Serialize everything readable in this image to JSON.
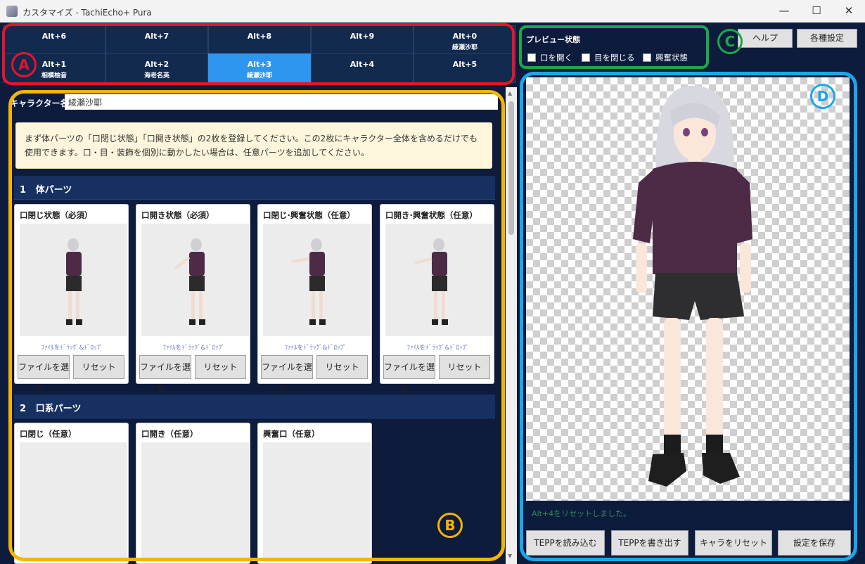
{
  "window": {
    "title": "カスタマイズ - TachiEcho+ Pura",
    "minimize": "—",
    "maximize": "☐",
    "close": "✕"
  },
  "shortcuts": [
    {
      "key": "Alt+6",
      "name": ""
    },
    {
      "key": "Alt+7",
      "name": ""
    },
    {
      "key": "Alt+8",
      "name": ""
    },
    {
      "key": "Alt+9",
      "name": ""
    },
    {
      "key": "Alt+0",
      "name": "綾瀬沙耶"
    },
    {
      "key": "Alt+1",
      "name": "相模柚音"
    },
    {
      "key": "Alt+2",
      "name": "海老名英"
    },
    {
      "key": "Alt+3",
      "name": "綾瀬沙耶",
      "active": true
    },
    {
      "key": "Alt+4",
      "name": ""
    },
    {
      "key": "Alt+5",
      "name": ""
    }
  ],
  "character": {
    "label": "キャラクター名",
    "value": "綾瀬沙耶"
  },
  "info": "まず体パーツの「口閉じ状態」「口開き状態」の2枚を登録してください。この2枚にキャラクター全体を含めるだけでも使用できます。口・目・装飾を個別に動かしたい場合は、任意パーツを追加してください。",
  "sections": {
    "body": {
      "number": "1",
      "title": "体パーツ"
    },
    "mouth": {
      "number": "2",
      "title": "口系パーツ"
    }
  },
  "body_cards": [
    {
      "title": "口閉じ状態（必須）",
      "drop": "ﾌｧｲﾙをﾄﾞﾗｯｸﾞ&ﾄﾞﾛｯﾌﾟ",
      "select": "ファイルを選択...",
      "reset": "リセット"
    },
    {
      "title": "口開き状態（必須）",
      "drop": "ﾌｧｲﾙをﾄﾞﾗｯｸﾞ&ﾄﾞﾛｯﾌﾟ",
      "select": "ファイルを選択...",
      "reset": "リセット"
    },
    {
      "title": "口閉じ·興奮状態（任意）",
      "drop": "ﾌｧｲﾙをﾄﾞﾗｯｸﾞ&ﾄﾞﾛｯﾌﾟ",
      "select": "ファイルを選択...",
      "reset": "リセット"
    },
    {
      "title": "口開き·興奮状態（任意）",
      "drop": "ﾌｧｲﾙをﾄﾞﾗｯｸﾞ&ﾄﾞﾛｯﾌﾟ",
      "select": "ファイルを選択...",
      "reset": "リセット"
    }
  ],
  "mouth_cards": [
    {
      "title": "口閉じ（任意）"
    },
    {
      "title": "口開き（任意）"
    },
    {
      "title": "興奮口（任意）"
    }
  ],
  "preview": {
    "title": "プレビュー状態",
    "options": [
      "口を開く",
      "目を閉じる",
      "興奮状態"
    ]
  },
  "top_buttons": {
    "help": "ヘルプ",
    "settings": "各種設定"
  },
  "status_message": "Alt+4をリセットしました。",
  "bottom_buttons": {
    "load": "TEPPを読み込む",
    "export": "TEPPを書き出す",
    "reset": "キャラをリセット",
    "save": "設定を保存"
  },
  "annotations": {
    "a": {
      "label": "A",
      "color": "#e8132b"
    },
    "b": {
      "label": "B",
      "color": "#f5b400"
    },
    "c": {
      "label": "C",
      "color": "#18a94a"
    },
    "d": {
      "label": "D",
      "color": "#1aa7ea"
    }
  },
  "colors": {
    "background": "#0d1b3d",
    "active_tab": "#2f96f0",
    "section_header": "#173062",
    "info_box": "#fdf6dc"
  }
}
